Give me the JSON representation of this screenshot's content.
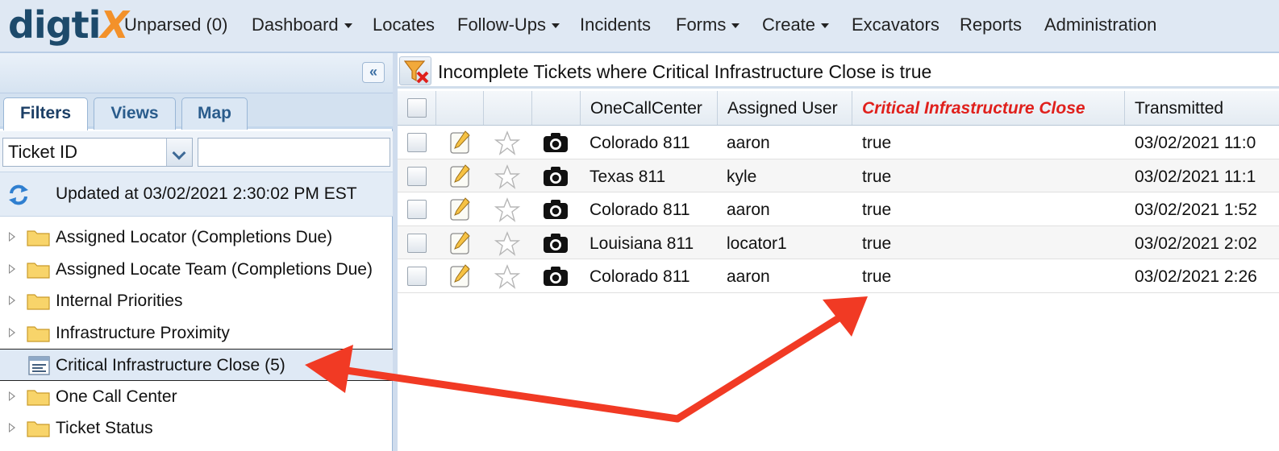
{
  "app": {
    "logo_part1": "digti",
    "logo_part2": "X"
  },
  "nav": [
    {
      "label": "Unparsed (0)",
      "dropdown": false
    },
    {
      "label": "Dashboard",
      "dropdown": true
    },
    {
      "label": "Locates",
      "dropdown": false
    },
    {
      "label": "Follow-Ups",
      "dropdown": true
    },
    {
      "label": "Incidents",
      "dropdown": false
    },
    {
      "label": "Forms",
      "dropdown": true
    },
    {
      "label": "Create",
      "dropdown": true
    },
    {
      "label": "Excavators",
      "dropdown": false
    },
    {
      "label": "Reports",
      "dropdown": false
    },
    {
      "label": "Administration",
      "dropdown": false
    }
  ],
  "sidebar": {
    "collapse_glyph": "«",
    "tabs": [
      {
        "label": "Filters",
        "active": true
      },
      {
        "label": "Views",
        "active": false
      },
      {
        "label": "Map",
        "active": false
      }
    ],
    "filter_field": {
      "selected": "Ticket ID",
      "value": ""
    },
    "updated_text": "Updated at 03/02/2021 2:30:02 PM EST",
    "tree": [
      {
        "label": "Assigned Locator (Completions Due)",
        "type": "folder"
      },
      {
        "label": "Assigned Locate Team (Completions Due)",
        "type": "folder"
      },
      {
        "label": "Internal Priorities",
        "type": "folder"
      },
      {
        "label": "Infrastructure Proximity",
        "type": "folder"
      },
      {
        "label": "Critical Infrastructure Close (5)",
        "type": "filter",
        "selected": true
      },
      {
        "label": "One Call Center",
        "type": "folder"
      },
      {
        "label": "Ticket Status",
        "type": "folder"
      }
    ]
  },
  "grid": {
    "title": "Incomplete Tickets where Critical Infrastructure Close is true",
    "columns": [
      "OneCallCenter",
      "Assigned User",
      "Critical Infrastructure Close",
      "Transmitted"
    ],
    "highlight_column_color": "#e0201c",
    "rows": [
      {
        "center": "Colorado 811",
        "user": "aaron",
        "critical": "true",
        "transmitted": "03/02/2021 11:0"
      },
      {
        "center": "Texas 811",
        "user": "kyle",
        "critical": "true",
        "transmitted": "03/02/2021 11:1"
      },
      {
        "center": "Colorado 811",
        "user": "aaron",
        "critical": "true",
        "transmitted": "03/02/2021 1:52"
      },
      {
        "center": "Louisiana 811",
        "user": "locator1",
        "critical": "true",
        "transmitted": "03/02/2021 2:02"
      },
      {
        "center": "Colorado 811",
        "user": "aaron",
        "critical": "true",
        "transmitted": "03/02/2021 2:26"
      }
    ]
  },
  "annotation": {
    "arrow_color": "#f13a24"
  }
}
